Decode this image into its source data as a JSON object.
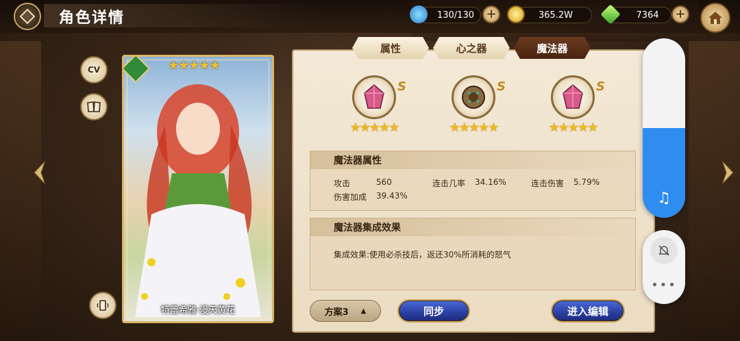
{
  "header": {
    "title": "角色详情",
    "resources": [
      {
        "name": "energy",
        "icon": "water-drop-icon",
        "value": "130/130"
      },
      {
        "name": "gold",
        "icon": "gold-coin-icon",
        "value": "365.2W"
      },
      {
        "name": "gem",
        "icon": "green-crystal-icon",
        "value": "7364"
      }
    ]
  },
  "side_buttons": {
    "cv_label": "CV"
  },
  "card": {
    "name": "特蕾希雅·漫天黄花",
    "stars": "★★★★★"
  },
  "tabs": [
    {
      "label": "属性",
      "active": false
    },
    {
      "label": "心之器",
      "active": false
    },
    {
      "label": "魔法器",
      "active": true
    }
  ],
  "artifacts": [
    {
      "grade": "S",
      "stars": "★★★★★",
      "icon": "pink-crystal-icon"
    },
    {
      "grade": "S",
      "stars": "★★★★★",
      "icon": "bronze-orb-icon"
    },
    {
      "grade": "S",
      "stars": "★★★★★",
      "icon": "pink-crystal-icon"
    }
  ],
  "magic_attributes": {
    "heading": "魔法器属性",
    "items": [
      {
        "label": "攻击",
        "value": "560"
      },
      {
        "label": "连击几率",
        "value": "34.16%"
      },
      {
        "label": "连击伤害",
        "value": "5.79%"
      },
      {
        "label": "伤害加成",
        "value": "39.43%"
      }
    ]
  },
  "set_effect": {
    "heading": "魔法器集成效果",
    "text": "集成效果:使用必杀技后，返还30%所消耗的怒气"
  },
  "footer": {
    "plan_label": "方案3",
    "sync_label": "同步",
    "edit_label": "进入编辑"
  },
  "system_volume": {
    "level": 0.5
  },
  "colors": {
    "accent_blue": "#2f8cf0",
    "gold": "#c9a35a",
    "active_tab": "#4a2410"
  }
}
